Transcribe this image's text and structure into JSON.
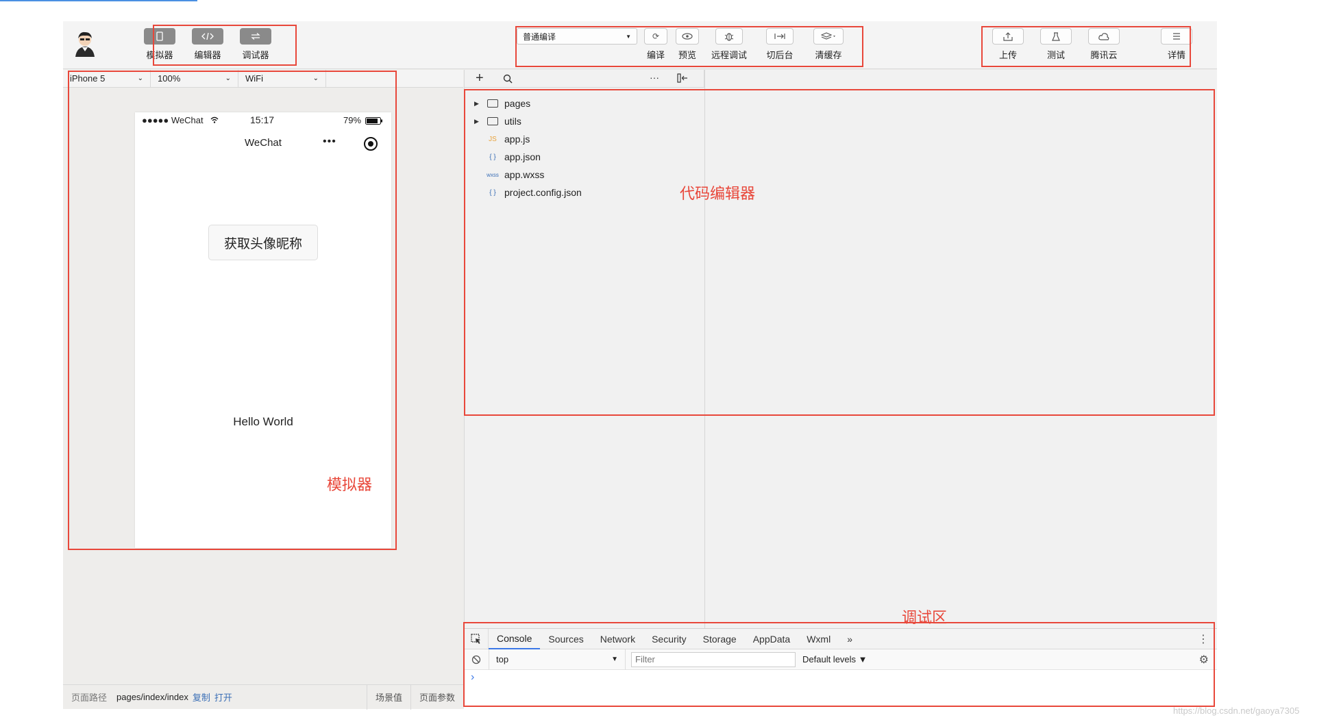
{
  "toolbar": {
    "mode_buttons": [
      {
        "label": "模拟器",
        "icon": "phone-icon"
      },
      {
        "label": "编辑器",
        "icon": "code-icon"
      },
      {
        "label": "调试器",
        "icon": "debug-switch-icon"
      }
    ],
    "compile_mode": "普通编译",
    "actions": [
      {
        "label": "编译",
        "icon": "refresh-icon"
      },
      {
        "label": "预览",
        "icon": "eye-icon"
      },
      {
        "label": "远程调试",
        "icon": "bug-icon"
      },
      {
        "label": "切后台",
        "icon": "background-icon"
      },
      {
        "label": "清缓存",
        "icon": "layers-icon"
      }
    ],
    "right_actions": [
      {
        "label": "上传",
        "icon": "upload-icon"
      },
      {
        "label": "测试",
        "icon": "flask-icon"
      },
      {
        "label": "腾讯云",
        "icon": "cloud-icon"
      },
      {
        "label": "详情",
        "icon": "menu-icon"
      }
    ]
  },
  "simulator": {
    "device": "iPhone 5",
    "zoom": "100%",
    "network": "WiFi",
    "status_carrier": "●●●●● WeChat",
    "status_time": "15:17",
    "status_battery": "79%",
    "nav_title": "WeChat",
    "nav_dots": "•••",
    "user_button": "获取头像昵称",
    "hello_text": "Hello World"
  },
  "annotations": {
    "simulator": "模拟器",
    "editor": "代码编辑器",
    "debugger": "调试区"
  },
  "path_bar": {
    "label": "页面路径",
    "path": "pages/index/index",
    "copy": "复制",
    "open": "打开",
    "scene": "场景值",
    "params": "页面参数"
  },
  "editor": {
    "add_icon": "+",
    "more_icon": "···",
    "files": [
      {
        "name": "pages",
        "type": "folder",
        "icon": ""
      },
      {
        "name": "utils",
        "type": "folder",
        "icon": ""
      },
      {
        "name": "app.js",
        "type": "js",
        "icon": "JS"
      },
      {
        "name": "app.json",
        "type": "json",
        "icon": "{ }"
      },
      {
        "name": "app.wxss",
        "type": "wxss",
        "icon": "wxss"
      },
      {
        "name": "project.config.json",
        "type": "json",
        "icon": "{ }"
      }
    ]
  },
  "debugger": {
    "tabs": [
      "Console",
      "Sources",
      "Network",
      "Security",
      "Storage",
      "AppData",
      "Wxml"
    ],
    "more_tabs": "»",
    "active_tab": "Console",
    "context": "top",
    "filter_placeholder": "Filter",
    "levels": "Default levels ▼",
    "prompt": "›"
  },
  "watermark": "https://blog.csdn.net/gaoya7305",
  "colors": {
    "annotation_red": "#e8473a",
    "active_tab": "#3b78e7",
    "link_blue": "#3b6fb6"
  }
}
